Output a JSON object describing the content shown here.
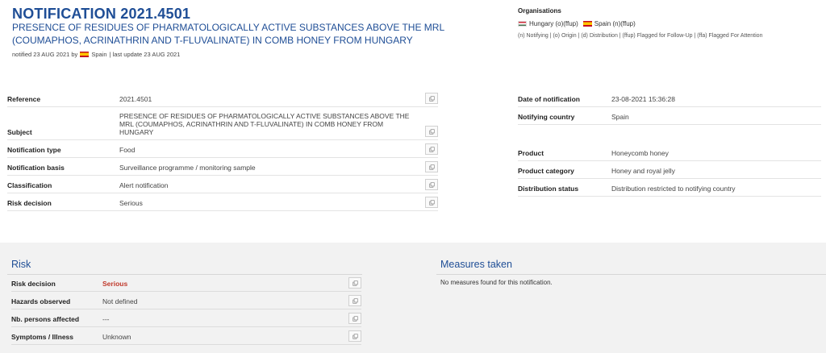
{
  "header": {
    "title": "NOTIFICATION 2021.4501",
    "subtitle": "PRESENCE OF RESIDUES OF PHARMATOLOGICALLY ACTIVE SUBSTANCES ABOVE THE MRL (COUMAPHOS, ACRINATHRIN AND T-FLUVALINATE) IN COMB HONEY FROM HUNGARY",
    "notified_prefix": "notified 23 AUG 2021 by",
    "notified_country": "Spain",
    "last_update": "| last update 23 AUG 2021"
  },
  "organisations": {
    "title": "Organisations",
    "items": [
      {
        "flag": "hungary-flag",
        "label": "Hungary (o)(ffup)"
      },
      {
        "flag": "spain-flag",
        "label": "Spain (n)(ffup)"
      }
    ],
    "legend": "(n) Notifying | (o) Origin | (d) Distribution | (ffup) Flagged for Follow-Up | (ffa) Flagged For Attention"
  },
  "details_left": [
    {
      "label": "Reference",
      "value": "2021.4501"
    },
    {
      "label": "Subject",
      "value": "PRESENCE OF RESIDUES OF PHARMATOLOGICALLY ACTIVE SUBSTANCES ABOVE THE MRL (COUMAPHOS, ACRINATHRIN AND T-FLUVALINATE) IN COMB HONEY FROM HUNGARY"
    },
    {
      "label": "Notification type",
      "value": "Food"
    },
    {
      "label": "Notification basis",
      "value": "Surveillance programme / monitoring sample"
    },
    {
      "label": "Classification",
      "value": "Alert notification"
    },
    {
      "label": "Risk decision",
      "value": "Serious"
    }
  ],
  "details_right": [
    {
      "label": "Date of notification",
      "value": "23-08-2021 15:36:28"
    },
    {
      "label": "Notifying country",
      "value": "Spain"
    },
    {
      "label": "Product",
      "value": "Honeycomb honey"
    },
    {
      "label": "Product category",
      "value": "Honey and royal jelly"
    },
    {
      "label": "Distribution status",
      "value": "Distribution restricted to notifying country"
    }
  ],
  "risk": {
    "title": "Risk",
    "rows": [
      {
        "label": "Risk decision",
        "value": "Serious"
      },
      {
        "label": "Hazards observed",
        "value": "Not defined"
      },
      {
        "label": "Nb. persons affected",
        "value": "---"
      },
      {
        "label": "Symptoms / Illness",
        "value": "Unknown"
      }
    ]
  },
  "measures": {
    "title": "Measures taken",
    "text": "No measures found for this notification."
  },
  "colors": {
    "accent": "#1f4e96",
    "serious": "#c0392b",
    "panel_bg": "#f2f2f2"
  }
}
